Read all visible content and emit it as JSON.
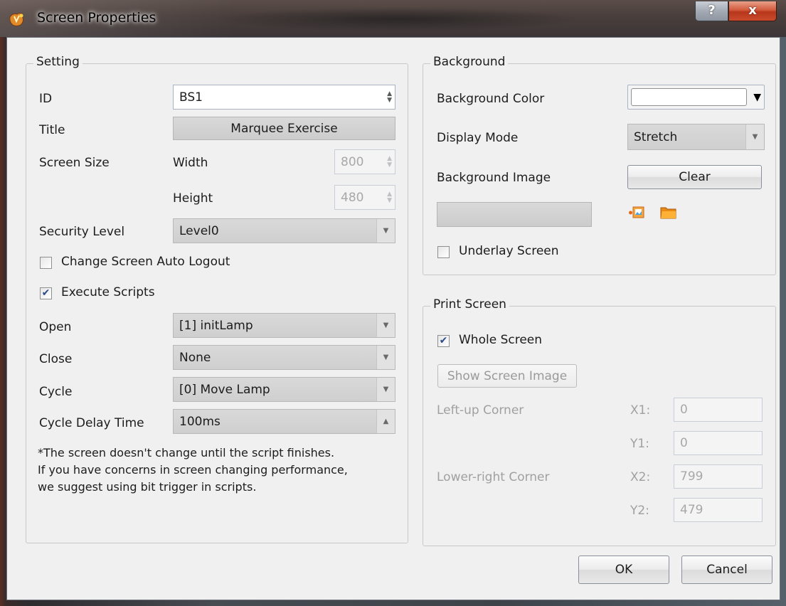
{
  "window": {
    "title": "Screen Properties",
    "help_label": "?",
    "close_label": "x"
  },
  "setting": {
    "group_title": "Setting",
    "id_label": "ID",
    "id_value": "BS1",
    "title_label": "Title",
    "title_value": "Marquee Exercise",
    "screen_size_label": "Screen Size",
    "width_label": "Width",
    "width_value": "800",
    "height_label": "Height",
    "height_value": "480",
    "security_label": "Security Level",
    "security_value": "Level0",
    "auto_logout_label": "Change Screen Auto Logout",
    "auto_logout_checked": false,
    "execute_scripts_label": "Execute Scripts",
    "execute_scripts_checked": true,
    "check_mark": "✔",
    "open_label": "Open",
    "open_value": "[1] initLamp",
    "close_label": "Close",
    "close_value": "None",
    "cycle_label": "Cycle",
    "cycle_value": "[0] Move Lamp",
    "cycle_delay_label": "Cycle Delay Time",
    "cycle_delay_value": "100ms",
    "note_line1": "*The screen doesn't change until the script finishes.",
    "note_line2": "If you have concerns in screen changing performance,",
    "note_line3": "we suggest using bit trigger in scripts."
  },
  "background": {
    "group_title": "Background",
    "color_label": "Background Color",
    "color_value": "#ffffff",
    "display_mode_label": "Display Mode",
    "display_mode_value": "Stretch",
    "image_label": "Background Image",
    "clear_label": "Clear",
    "image_path_value": "",
    "underlay_label": "Underlay Screen",
    "underlay_checked": false
  },
  "print_screen": {
    "group_title": "Print Screen",
    "whole_screen_label": "Whole Screen",
    "whole_screen_checked": true,
    "show_image_label": "Show Screen Image",
    "left_up_label": "Left-up Corner",
    "lower_right_label": "Lower-right Corner",
    "x1_label": "X1:",
    "x1_value": "0",
    "y1_label": "Y1:",
    "y1_value": "0",
    "x2_label": "X2:",
    "x2_value": "799",
    "y2_label": "Y2:",
    "y2_value": "479"
  },
  "footer": {
    "ok_label": "OK",
    "cancel_label": "Cancel"
  },
  "icons": {
    "up_down": "▲▼",
    "dropdown": "▼",
    "up": "▲"
  }
}
